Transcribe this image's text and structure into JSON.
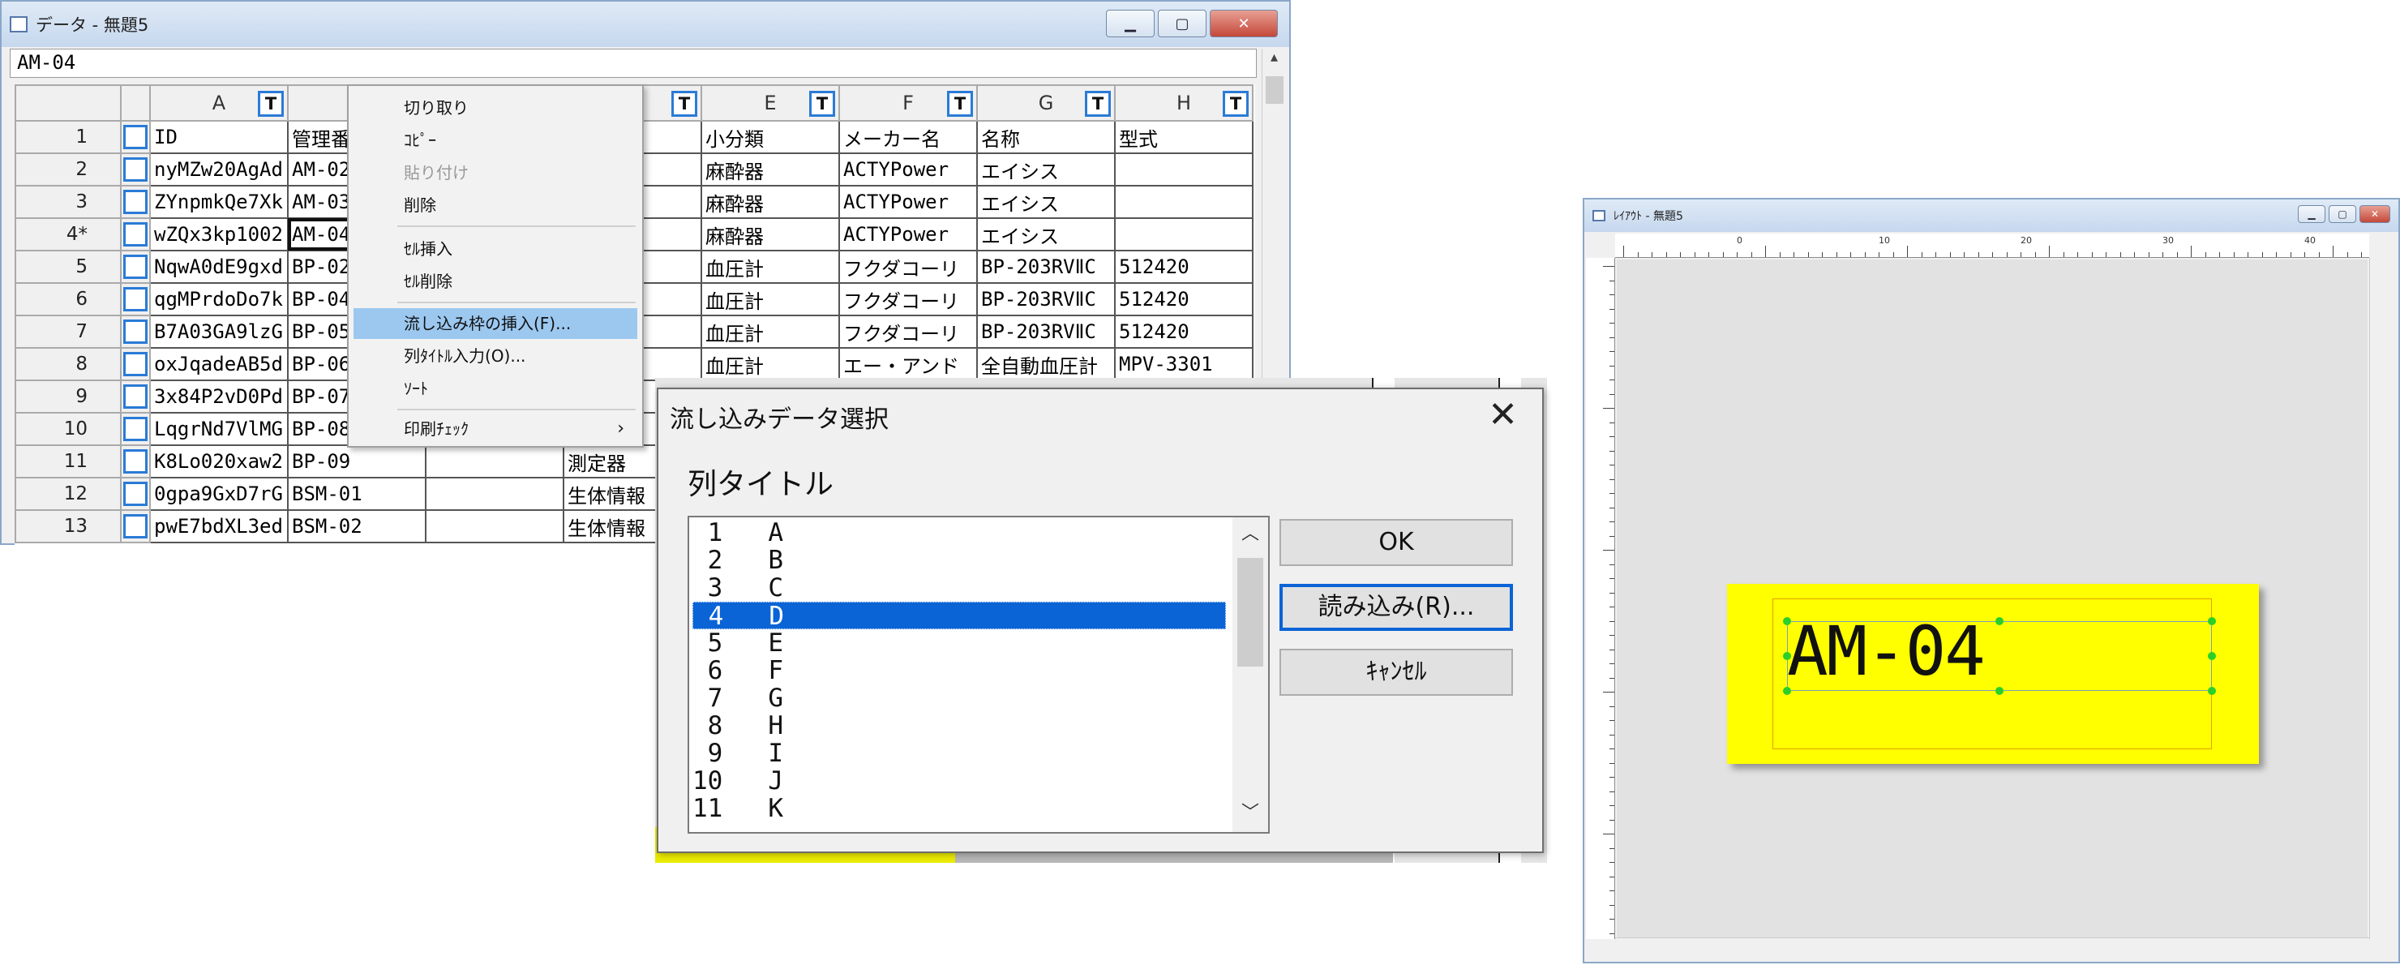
{
  "data_window": {
    "title": "データ - 無題5",
    "formula_value": "AM-04",
    "columns": [
      {
        "letter": "A",
        "t": "T"
      },
      {
        "letter": "",
        "t": ""
      },
      {
        "letter": "",
        "t": ""
      },
      {
        "letter": "",
        "t": "T"
      },
      {
        "letter": "E",
        "t": "T"
      },
      {
        "letter": "F",
        "t": "T"
      },
      {
        "letter": "G",
        "t": "T"
      },
      {
        "letter": "H",
        "t": "T"
      }
    ],
    "rows": [
      {
        "num": "1",
        "cells": [
          "ID",
          "管理番",
          "",
          "",
          "小分類",
          "メーカー名",
          "名称",
          "型式"
        ]
      },
      {
        "num": "2",
        "cells": [
          "nyMZw20AgAd",
          "AM-02",
          "",
          "",
          "麻酔器",
          "ACTYPower",
          "エイシス",
          ""
        ]
      },
      {
        "num": "3",
        "cells": [
          "ZYnpmkQe7Xk",
          "AM-03",
          "",
          "",
          "麻酔器",
          "ACTYPower",
          "エイシス",
          ""
        ]
      },
      {
        "num": "4*",
        "cells": [
          "wZQx3kp1002",
          "AM-04",
          "",
          "",
          "麻酔器",
          "ACTYPower",
          "エイシス",
          ""
        ]
      },
      {
        "num": "5",
        "cells": [
          "NqwA0dE9gxd",
          "BP-02",
          "",
          "",
          "血圧計",
          "フクダコーリ",
          "BP-203RVⅡC",
          "512420"
        ]
      },
      {
        "num": "6",
        "cells": [
          "qgMPrdoDo7k",
          "BP-04",
          "",
          "",
          "血圧計",
          "フクダコーリ",
          "BP-203RVⅡC",
          "512420"
        ]
      },
      {
        "num": "7",
        "cells": [
          "B7A03GA9lzG",
          "BP-05",
          "",
          "",
          "血圧計",
          "フクダコーリ",
          "BP-203RVⅡC",
          "512420"
        ]
      },
      {
        "num": "8",
        "cells": [
          "oxJqadeAB5d",
          "BP-06",
          "",
          "",
          "血圧計",
          "エー・アンド",
          "全自動血圧計",
          "MPV-3301"
        ]
      },
      {
        "num": "9",
        "cells": [
          "3x84P2vD0Pd",
          "BP-07",
          "",
          "",
          "",
          "",
          "",
          ""
        ]
      },
      {
        "num": "10",
        "cells": [
          "LqgrNd7VlMG",
          "BP-08",
          "",
          "",
          "",
          "",
          "",
          ""
        ]
      },
      {
        "num": "11",
        "cells": [
          "K8Lo020xaw2",
          "BP-09",
          "",
          "測定器",
          "",
          "",
          "",
          ""
        ]
      },
      {
        "num": "12",
        "cells": [
          "0gpa9GxD7rG",
          "BSM-01",
          "",
          "生体情報",
          "",
          "",
          "",
          ""
        ]
      },
      {
        "num": "13",
        "cells": [
          "pwE7bdXL3ed",
          "BSM-02",
          "",
          "生体情報",
          "",
          "",
          "",
          ""
        ]
      }
    ]
  },
  "context_menu": {
    "items": [
      {
        "label": "切り取り",
        "disabled": false
      },
      {
        "label": "ｺﾋﾟｰ",
        "disabled": false
      },
      {
        "label": "貼り付け",
        "disabled": true
      },
      {
        "label": "削除",
        "disabled": false
      },
      {
        "label": "ｾﾙ挿入",
        "disabled": false
      },
      {
        "label": "ｾﾙ削除",
        "disabled": false
      },
      {
        "label": "流し込み枠の挿入(F)...",
        "disabled": false
      },
      {
        "label": "列ﾀｲﾄﾙ入力(O)...",
        "disabled": false
      },
      {
        "label": "ｿｰﾄ",
        "disabled": false
      },
      {
        "label": "印刷ﾁｪｯｸ",
        "disabled": false
      }
    ],
    "submenu_arrow": "›"
  },
  "dialog": {
    "title": "流し込みデータ選択",
    "close_glyph": "✕",
    "list_label": "列タイトル",
    "items": [
      " 1   A",
      " 2   B",
      " 3   C",
      " 4   D",
      " 5   E",
      " 6   F",
      " 7   G",
      " 8   H",
      " 9   I",
      "10   J",
      "11   K"
    ],
    "selected_index": 3,
    "buttons": {
      "ok": "OK",
      "load": "読み込み(R)...",
      "cancel": "ｷｬﾝｾﾙ"
    }
  },
  "layout_window": {
    "title": "ﾚｲｱｳﾄ - 無題5",
    "field_text": "AM-04",
    "ruler_labels": [
      "0",
      "10",
      "20",
      "30",
      "40"
    ]
  },
  "colors": {
    "accent": "#0a64d6",
    "label_background": "#ffff00",
    "menu_highlight": "#9cc8f0"
  },
  "icons": {
    "window": "window-icon",
    "minimize": "minimize-icon",
    "maximize": "maximize-icon",
    "close": "close-icon",
    "checkbox": "checkbox-icon",
    "text_type": "text-type-icon",
    "scroll_up": "chevron-up-icon",
    "scroll_down": "chevron-down-icon"
  }
}
